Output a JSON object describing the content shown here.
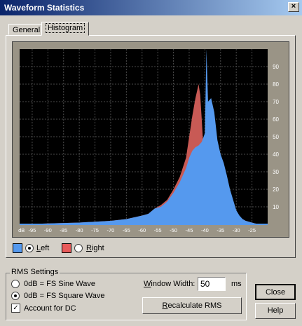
{
  "window": {
    "title": "Waveform Statistics",
    "close_glyph": "×"
  },
  "tabs": [
    {
      "label": "General"
    },
    {
      "label": "Histogram"
    }
  ],
  "chart_data": {
    "type": "area",
    "xlim": [
      -99,
      -20
    ],
    "ylim": [
      0,
      100
    ],
    "x_ticks": [
      "dB",
      "-95",
      "-90",
      "-85",
      "-80",
      "-75",
      "-70",
      "-65",
      "-60",
      "-55",
      "-50",
      "-45",
      "-40",
      "-35",
      "-30",
      "-25"
    ],
    "y_ticks": [
      "10",
      "20",
      "30",
      "40",
      "50",
      "60",
      "70",
      "80",
      "90"
    ],
    "grid": true,
    "series": [
      {
        "name": "Left",
        "color": "#5599ee",
        "x": [
          -99,
          -90,
          -80,
          -70,
          -65,
          -60,
          -58,
          -56,
          -54,
          -52,
          -50,
          -48,
          -46,
          -45,
          -44,
          -43,
          -42,
          -41,
          -40,
          -39.5,
          -39,
          -38,
          -37,
          -36,
          -35,
          -34,
          -33,
          -32,
          -31,
          -30,
          -29,
          -28,
          -27,
          -26,
          -25,
          -24,
          -22
        ],
        "values": [
          0,
          0.5,
          1,
          2,
          3,
          5,
          6,
          9,
          10,
          13,
          18,
          24,
          32,
          38,
          42,
          44,
          45,
          47,
          52,
          100,
          70,
          72,
          64,
          48,
          40,
          35,
          28,
          20,
          14,
          8,
          5,
          3,
          2,
          1.5,
          1,
          0.5,
          0
        ]
      },
      {
        "name": "Right",
        "color": "#c85a55",
        "x": [
          -99,
          -90,
          -80,
          -70,
          -65,
          -60,
          -58,
          -56,
          -54,
          -52,
          -50,
          -48,
          -46,
          -45,
          -44,
          -43,
          -42.5,
          -42,
          -41.5,
          -41,
          -40.5,
          -40,
          -39,
          -38,
          -37,
          -36,
          -35,
          -34,
          -33,
          -32,
          -31,
          -30,
          -29,
          -28,
          -27,
          -26,
          -25,
          -24,
          -22
        ],
        "values": [
          0,
          0.5,
          1,
          2,
          3,
          5,
          6,
          9,
          11,
          14,
          20,
          27,
          38,
          50,
          62,
          72,
          76,
          80,
          74,
          60,
          45,
          38,
          35,
          33,
          34,
          40,
          30,
          24,
          20,
          15,
          10,
          6,
          4,
          3,
          2,
          1.5,
          1,
          0.5,
          0
        ]
      }
    ]
  },
  "legend": {
    "left": {
      "label_u": "L",
      "label_rest": "eft",
      "color": "#5599ee",
      "selected": true
    },
    "right": {
      "label_u": "R",
      "label_rest": "ight",
      "color": "#e85a5a",
      "selected": false
    }
  },
  "rms": {
    "group_title": "RMS Settings",
    "sine_label": "0dB = FS Sine Wave",
    "square_label": "0dB = FS Square Wave",
    "selected": "square",
    "dc_label": "Account for DC",
    "dc_checked": true,
    "window_width_label_u": "W",
    "window_width_label_rest": "indow Width:",
    "window_width_value": "50",
    "window_width_unit": "ms",
    "recalc_u": "R",
    "recalc_rest": "ecalculate RMS"
  },
  "buttons": {
    "close": "Close",
    "help": "Help"
  }
}
